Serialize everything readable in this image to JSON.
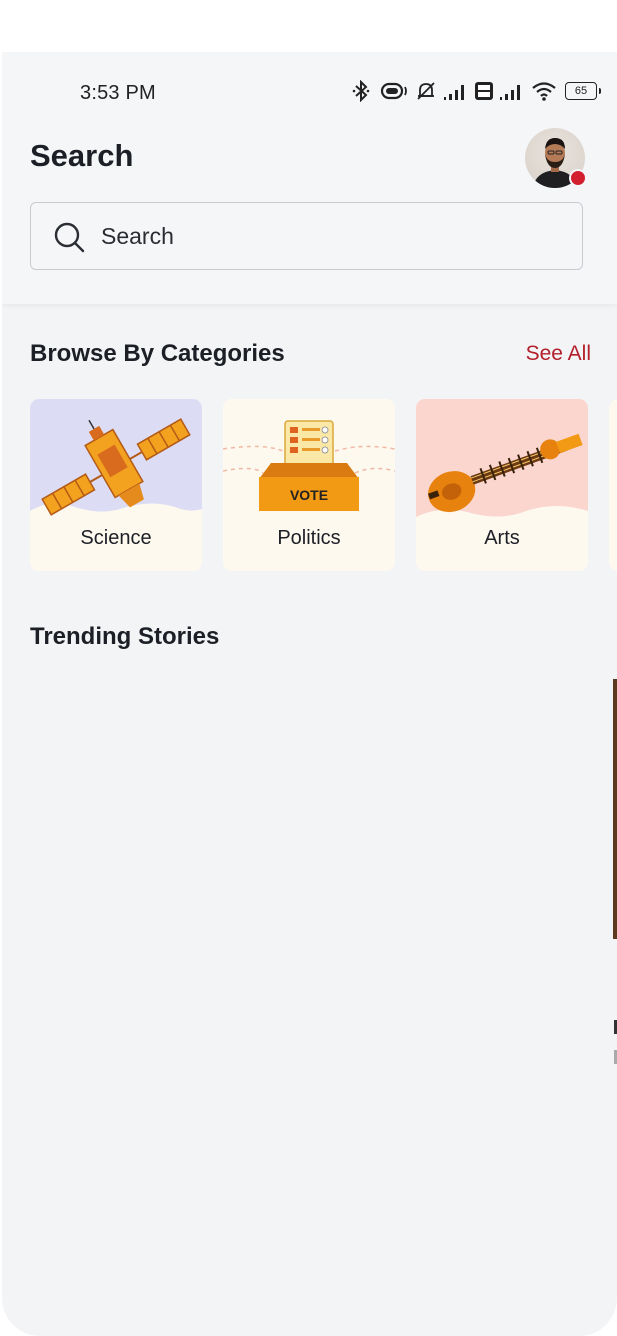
{
  "status_bar": {
    "time": "3:53 PM",
    "battery": "65",
    "icons": [
      "bluetooth-icon",
      "vibrate-icon",
      "mute-bell-icon",
      "signal-icon",
      "volte-icon",
      "signal-icon",
      "wifi-icon",
      "battery-icon"
    ]
  },
  "header": {
    "title": "Search",
    "avatar": "profile-avatar",
    "notification_dot_color": "#d3202f"
  },
  "search": {
    "placeholder": "Search",
    "value": ""
  },
  "categories": {
    "title": "Browse By Categories",
    "see_all": "See All",
    "accent": "#b3202b",
    "items": [
      {
        "label": "Science",
        "icon": "satellite-icon",
        "bg": "#dcdcf4"
      },
      {
        "label": "Politics",
        "icon": "vote-box-icon",
        "bg": "#fdf9ef"
      },
      {
        "label": "Arts",
        "icon": "sitar-icon",
        "bg": "#fbd6cf"
      }
    ]
  },
  "trending": {
    "title": "Trending Stories"
  }
}
